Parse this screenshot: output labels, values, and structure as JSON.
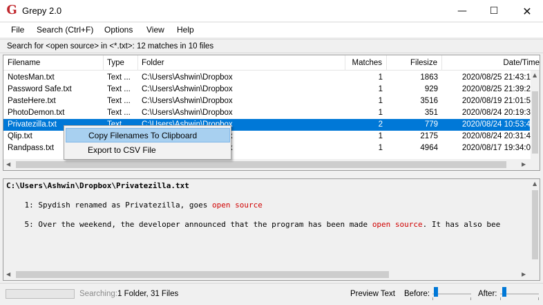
{
  "window": {
    "icon_letter": "G",
    "title": "Grepy 2.0",
    "min_glyph": "—",
    "max_glyph": "☐",
    "close_glyph": "✕"
  },
  "menu": [
    "File",
    "Search (Ctrl+F)",
    "Options",
    "View",
    "Help"
  ],
  "status_line": "Search for <open source> in <*.txt>: 12 matches in 10 files",
  "table": {
    "columns": [
      "Filename",
      "Type",
      "Folder",
      "Matches",
      "Filesize",
      "Date/Time"
    ],
    "rows": [
      {
        "filename": "NotesMan.txt",
        "type": "Text ...",
        "folder": "C:\\Users\\Ashwin\\Dropbox",
        "matches": "1",
        "filesize": "1863",
        "datetime": "2020/08/25 21:43:1"
      },
      {
        "filename": "Password Safe.txt",
        "type": "Text ...",
        "folder": "C:\\Users\\Ashwin\\Dropbox",
        "matches": "1",
        "filesize": "929",
        "datetime": "2020/08/25 21:39:2"
      },
      {
        "filename": "PasteHere.txt",
        "type": "Text ...",
        "folder": "C:\\Users\\Ashwin\\Dropbox",
        "matches": "1",
        "filesize": "3516",
        "datetime": "2020/08/19 21:01:5"
      },
      {
        "filename": "PhotoDemon.txt",
        "type": "Text ...",
        "folder": "C:\\Users\\Ashwin\\Dropbox",
        "matches": "1",
        "filesize": "351",
        "datetime": "2020/08/24 20:19:3"
      },
      {
        "filename": "Privatezilla.txt",
        "type": "Text ...",
        "folder": "C:\\Users\\Ashwin\\Dropbox",
        "matches": "2",
        "filesize": "779",
        "datetime": "2020/08/24 10:53:4"
      },
      {
        "filename": "Qlip.txt",
        "type": "Text ...",
        "folder": "C:\\Users\\Ashwin\\Dropbox",
        "matches": "1",
        "filesize": "2175",
        "datetime": "2020/08/24 20:31:4"
      },
      {
        "filename": "Randpass.txt",
        "type": "Text ...",
        "folder": "C:\\Users\\Ashwin\\Dropbox",
        "matches": "1",
        "filesize": "4964",
        "datetime": "2020/08/17 19:34:0"
      }
    ],
    "selected_index": 4
  },
  "context_menu": [
    "Copy Filenames To Clipboard",
    "Export to CSV File"
  ],
  "preview": {
    "path": "C:\\Users\\Ashwin\\Dropbox\\Privatezilla.txt",
    "lines": [
      {
        "prefix": "    1: Spydish renamed as Privatezilla, goes ",
        "highlight": "open source",
        "suffix": ""
      },
      {
        "prefix": "    5: Over the weekend, the developer announced that the program has been made ",
        "highlight": "open source",
        "suffix": ". It has also bee"
      }
    ],
    "highlight_color": "#d00000"
  },
  "footer": {
    "searching_label": "Searching:",
    "searching_value": "1 Folder,  31 Files",
    "preview_text": "Preview Text",
    "before_label": "Before:",
    "after_label": "After:"
  },
  "colors": {
    "selection": "#0078d7",
    "menu_hover": "#a8d0f0",
    "app_icon": "#c0282d"
  }
}
